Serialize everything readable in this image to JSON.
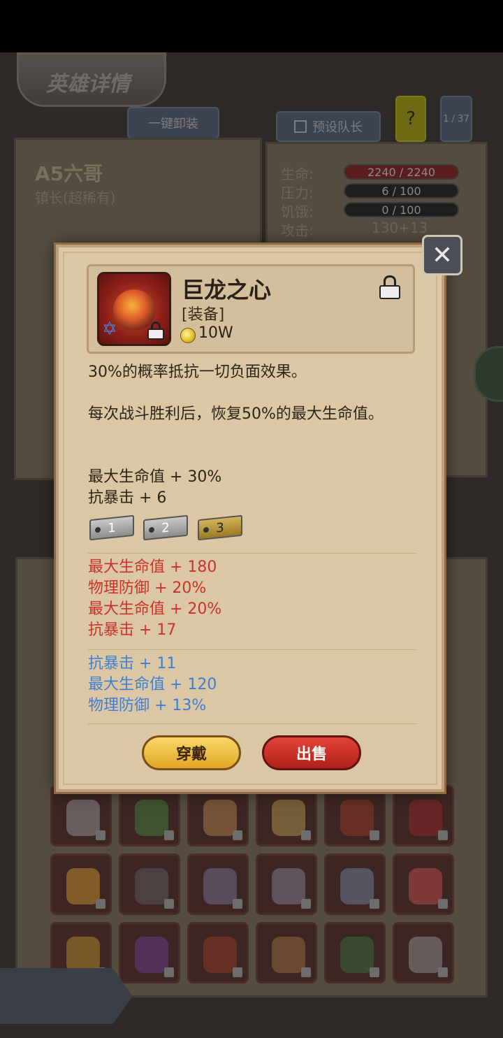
{
  "background": {
    "title": "英雄详情",
    "unequip_all": "一键卸装",
    "preset_captain": "预设队长",
    "help": "?",
    "page_counter": "1 / 37",
    "hero_name": "A5六哥",
    "hero_role": "镇长(超稀有)",
    "stats": [
      {
        "label": "生命:",
        "value": "2240 / 2240"
      },
      {
        "label": "压力:",
        "value": "6 / 100"
      },
      {
        "label": "饥饿:",
        "value": "0 / 100"
      },
      {
        "label": "攻击:",
        "value": "130+13"
      }
    ]
  },
  "modal": {
    "close_icon": "close-x-icon",
    "item": {
      "name": "巨龙之心",
      "type": "[装备]",
      "price": "10W",
      "icon": "dragon-heart-icon"
    },
    "descriptions": [
      "30%的概率抵抗一切负面效果。",
      "每次战斗胜利后，恢复50%的最大生命值。"
    ],
    "base_stats": [
      "最大生命值 + 30%",
      "抗暴击 + 6"
    ],
    "tiers": [
      "1",
      "2",
      "3"
    ],
    "red_stats": [
      "最大生命值 + 180",
      "物理防御 + 20%",
      "最大生命值 + 20%",
      "抗暴击 + 17"
    ],
    "blue_stats": [
      "抗暴击 + 11",
      "最大生命值 + 120",
      "物理防御 + 13%"
    ],
    "buttons": {
      "wear": "穿戴",
      "sell": "出售"
    }
  },
  "colors": {
    "red_stat": "#c8332b",
    "blue_stat": "#3f7fd3",
    "modal_bg": "#dcc7a5"
  }
}
